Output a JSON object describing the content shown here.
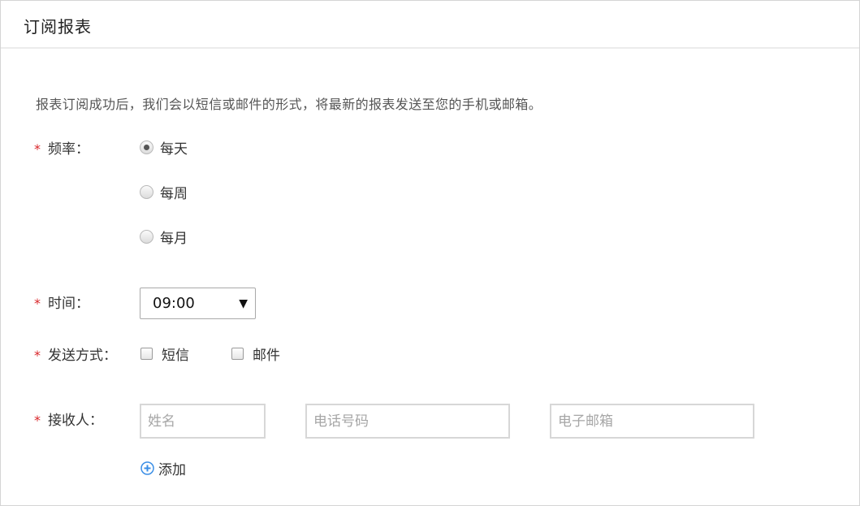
{
  "header": {
    "title": "订阅报表"
  },
  "intro": "报表订阅成功后，我们会以短信或邮件的形式，将最新的报表发送至您的手机或邮箱。",
  "required_mark": "*",
  "frequency": {
    "label": "频率：",
    "options": [
      "每天",
      "每周",
      "每月"
    ],
    "selected": "每天"
  },
  "time": {
    "label": "时间：",
    "value": "09:00"
  },
  "send_method": {
    "label": "发送方式：",
    "options": [
      "短信",
      "邮件"
    ]
  },
  "recipient": {
    "label": "接收人：",
    "name_placeholder": "姓名",
    "phone_placeholder": "电话号码",
    "email_placeholder": "电子邮箱",
    "add_label": "添加"
  },
  "colors": {
    "required": "#d9262a",
    "accent": "#3a8ee6",
    "border": "#d7d7d7"
  },
  "icons": {
    "add": "plus-circle-icon",
    "dropdown": "caret-down-icon"
  }
}
